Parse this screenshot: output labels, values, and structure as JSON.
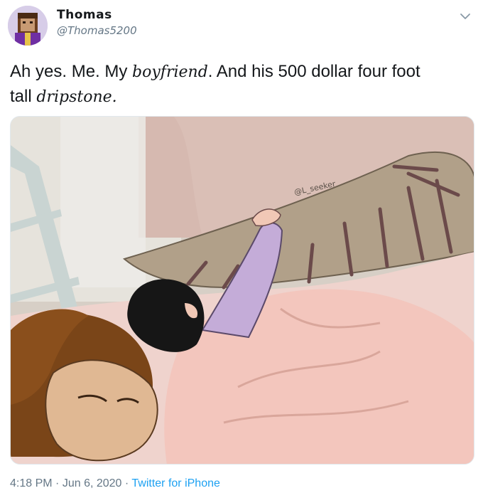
{
  "tweet": {
    "display_name": "Thomas",
    "username": "@Thomas5200",
    "text_parts": {
      "p1": "Ah yes. Me. My ",
      "p2": "boyfriend",
      "p3": ". And his 500 dollar four foot",
      "p4": "tall ",
      "p5": "dripstone."
    },
    "watermark": "@L_seeker",
    "time": "4:18 PM",
    "separator": "·",
    "date": "Jun 6, 2020",
    "source": "Twitter for iPhone"
  },
  "icons": {
    "menu": "chevron-down-icon",
    "avatar": "avatar"
  },
  "colors": {
    "link": "#1da1f2",
    "secondary_text": "#657786",
    "primary_text": "#14171a"
  }
}
